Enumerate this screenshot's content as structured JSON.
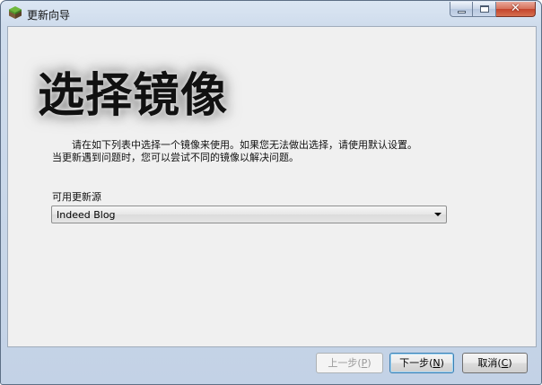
{
  "window": {
    "title": "更新向导",
    "icons": {
      "app": "grass-block-icon",
      "minimize": "minimize-icon",
      "maximize": "maximize-icon",
      "close": "close-icon"
    }
  },
  "page": {
    "heading": "选择镜像",
    "description_line1": "请在如下列表中选择一个镜像来使用。如果您无法做出选择，请使用默认设置。",
    "description_line2": "当更新遇到问题时，您可以尝试不同的镜像以解决问题。",
    "source_label": "可用更新源",
    "source_selected": "Indeed Blog"
  },
  "buttons": {
    "back_label": "上一步(",
    "back_key": "P",
    "back_close": ")",
    "next_label": "下一步(",
    "next_key": "N",
    "next_close": ")",
    "cancel_label": "取消(",
    "cancel_key": "C",
    "cancel_close": ")"
  },
  "colors": {
    "title_bar": "#cfdcec",
    "client_bg": "#f0f0f0",
    "default_button_border": "#3c7fb1",
    "close_button": "#c4442c"
  }
}
